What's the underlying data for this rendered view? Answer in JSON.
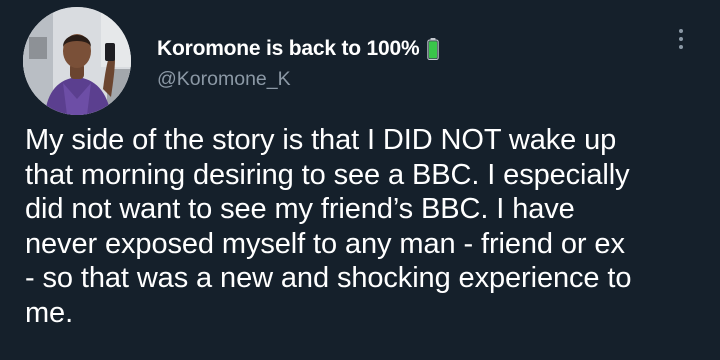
{
  "tweet": {
    "display_name": "Koromone is back to 100%",
    "handle": "@Koromone_K",
    "emoji_icon": "battery-icon",
    "more_icon": "more-vertical-icon",
    "text_lines": [
      "My side of the story is that I DID NOT wake up",
      "that morning desiring to see a BBC. I especially",
      "did not want to see my friend’s BBC. I have",
      "never exposed myself to any man - friend or ex",
      "- so that was a new and shocking experience to",
      "me."
    ]
  },
  "colors": {
    "background": "#15202b",
    "text_primary": "#ffffff",
    "text_secondary": "#8b98a5",
    "battery_green": "#39c54a"
  }
}
